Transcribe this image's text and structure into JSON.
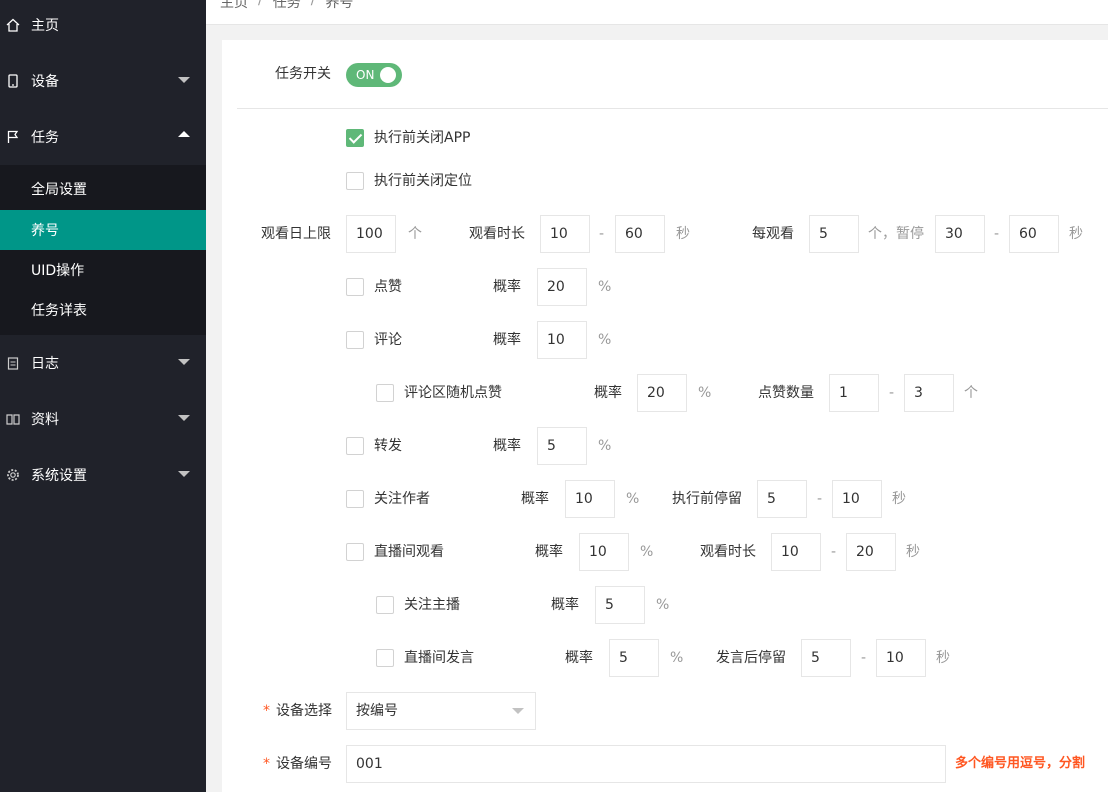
{
  "sidebar": {
    "home": "主页",
    "device": "设备",
    "task": "任务",
    "task_sub": [
      "全局设置",
      "养号",
      "UID操作",
      "任务详表"
    ],
    "log": "日志",
    "material": "资料",
    "system": "系统设置"
  },
  "breadcrumb": [
    "主页",
    "任务",
    "养号"
  ],
  "breadcrumb_sep": "/",
  "form": {
    "task_switch_label": "任务开关",
    "task_switch_value": "ON",
    "close_app": "执行前关闭APP",
    "close_location": "执行前关闭定位",
    "watch_limit_label": "观看日上限",
    "watch_limit": "100",
    "unit_ge": "个",
    "watch_duration_label": "观看时长",
    "watch_min": "10",
    "watch_max": "60",
    "unit_sec": "秒",
    "dash": "-",
    "per_watch_label": "每观看",
    "per_watch": "5",
    "pause_label": "个，暂停",
    "pause_min": "30",
    "pause_max": "60",
    "prob_label": "概率",
    "percent": "%",
    "like": "点赞",
    "like_prob": "20",
    "comment": "评论",
    "comment_prob": "10",
    "comment_like": "评论区随机点赞",
    "comment_like_prob": "20",
    "like_count_label": "点赞数量",
    "like_count_min": "1",
    "like_count_max": "3",
    "share": "转发",
    "share_prob": "5",
    "follow_author": "关注作者",
    "follow_prob": "10",
    "stay_before_label": "执行前停留",
    "stay_min": "5",
    "stay_max": "10",
    "live_watch": "直播间观看",
    "live_prob": "10",
    "live_duration_label": "观看时长",
    "live_min": "10",
    "live_max": "20",
    "follow_host": "关注主播",
    "follow_host_prob": "5",
    "live_speak": "直播间发言",
    "speak_prob": "5",
    "stay_after_label": "发言后停留",
    "speak_min": "5",
    "speak_max": "10",
    "required_mark": "*",
    "device_select_label": "设备选择",
    "device_select_value": "按编号",
    "device_no_label": "设备编号",
    "device_no_value": "001",
    "device_no_tip": "多个编号用逗号，分割"
  },
  "colors": {
    "sidebar": "#20222a",
    "active": "#009688",
    "switch": "#5fb878",
    "tip": "#ff5722"
  }
}
